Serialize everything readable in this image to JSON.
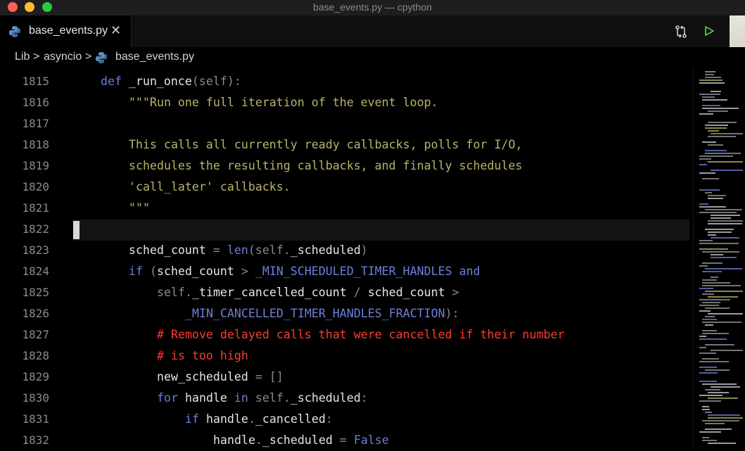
{
  "window": {
    "title": "base_events.py — cpython"
  },
  "tab": {
    "label": "base_events.py",
    "close_glyph": "✕"
  },
  "breadcrumb": {
    "parts": [
      "Lib",
      "asyncio",
      "base_events.py"
    ],
    "separator": ">"
  },
  "editor": {
    "cursor_line": 1822,
    "lines": [
      {
        "no": "1815",
        "tokens": [
          [
            "k",
            "def "
          ],
          [
            "fn",
            "_run_once"
          ],
          [
            "p",
            "("
          ],
          [
            "self",
            "self"
          ],
          [
            "p",
            "):"
          ]
        ],
        "indent": 0
      },
      {
        "no": "1816",
        "tokens": [
          [
            "doc",
            "\"\"\"Run one full iteration of the event loop."
          ]
        ],
        "indent": 1
      },
      {
        "no": "1817",
        "tokens": [],
        "indent": 1
      },
      {
        "no": "1818",
        "tokens": [
          [
            "doc",
            "This calls all currently ready callbacks, polls for I/O,"
          ]
        ],
        "indent": 1
      },
      {
        "no": "1819",
        "tokens": [
          [
            "doc",
            "schedules the resulting callbacks, and finally schedules"
          ]
        ],
        "indent": 1
      },
      {
        "no": "1820",
        "tokens": [
          [
            "doc",
            "'call_later' callbacks."
          ]
        ],
        "indent": 1
      },
      {
        "no": "1821",
        "tokens": [
          [
            "doc",
            "\"\"\""
          ]
        ],
        "indent": 1
      },
      {
        "no": "1822",
        "tokens": [],
        "indent": 0
      },
      {
        "no": "1823",
        "tokens": [
          [
            "fn",
            "sched_count "
          ],
          [
            "op",
            "= "
          ],
          [
            "k",
            "len"
          ],
          [
            "p",
            "("
          ],
          [
            "self",
            "self"
          ],
          [
            "p",
            "."
          ],
          [
            "fn",
            "_scheduled"
          ],
          [
            "p",
            ")"
          ]
        ],
        "indent": 1
      },
      {
        "no": "1824",
        "tokens": [
          [
            "k",
            "if "
          ],
          [
            "p",
            "("
          ],
          [
            "fn",
            "sched_count "
          ],
          [
            "op",
            "> "
          ],
          [
            "c",
            "_MIN_SCHEDULED_TIMER_HANDLES "
          ],
          [
            "k",
            "and"
          ]
        ],
        "indent": 1
      },
      {
        "no": "1825",
        "tokens": [
          [
            "self",
            "self"
          ],
          [
            "p",
            "."
          ],
          [
            "fn",
            "_timer_cancelled_count "
          ],
          [
            "op",
            "/ "
          ],
          [
            "fn",
            "sched_count "
          ],
          [
            "op",
            ">"
          ]
        ],
        "indent": 2
      },
      {
        "no": "1826",
        "tokens": [
          [
            "c",
            "_MIN_CANCELLED_TIMER_HANDLES_FRACTION"
          ],
          [
            "p",
            "):"
          ]
        ],
        "indent": 3
      },
      {
        "no": "1827",
        "tokens": [
          [
            "cm",
            "# Remove delayed calls that were cancelled if their number"
          ]
        ],
        "indent": 2
      },
      {
        "no": "1828",
        "tokens": [
          [
            "cm",
            "# is too high"
          ]
        ],
        "indent": 2
      },
      {
        "no": "1829",
        "tokens": [
          [
            "fn",
            "new_scheduled "
          ],
          [
            "op",
            "= "
          ],
          [
            "p",
            "[]"
          ]
        ],
        "indent": 2
      },
      {
        "no": "1830",
        "tokens": [
          [
            "k",
            "for "
          ],
          [
            "fn",
            "handle "
          ],
          [
            "k",
            "in "
          ],
          [
            "self",
            "self"
          ],
          [
            "p",
            "."
          ],
          [
            "fn",
            "_scheduled"
          ],
          [
            "p",
            ":"
          ]
        ],
        "indent": 2
      },
      {
        "no": "1831",
        "tokens": [
          [
            "k",
            "if "
          ],
          [
            "fn",
            "handle"
          ],
          [
            "p",
            "."
          ],
          [
            "fn",
            "_cancelled"
          ],
          [
            "p",
            ":"
          ]
        ],
        "indent": 3
      },
      {
        "no": "1832",
        "tokens": [
          [
            "fn",
            "handle"
          ],
          [
            "p",
            "."
          ],
          [
            "fn",
            "_scheduled "
          ],
          [
            "op",
            "= "
          ],
          [
            "k",
            "False"
          ]
        ],
        "indent": 4
      }
    ]
  },
  "colors": {
    "keyword": "#6d7fd8",
    "docstring": "#b9b46a",
    "comment": "#ff3b30",
    "line_number": "#8a8a8a"
  },
  "icons": {
    "tab_file": "python-icon",
    "breadcrumb_file": "python-icon",
    "compare": "compare-changes-icon",
    "run": "run-icon"
  }
}
